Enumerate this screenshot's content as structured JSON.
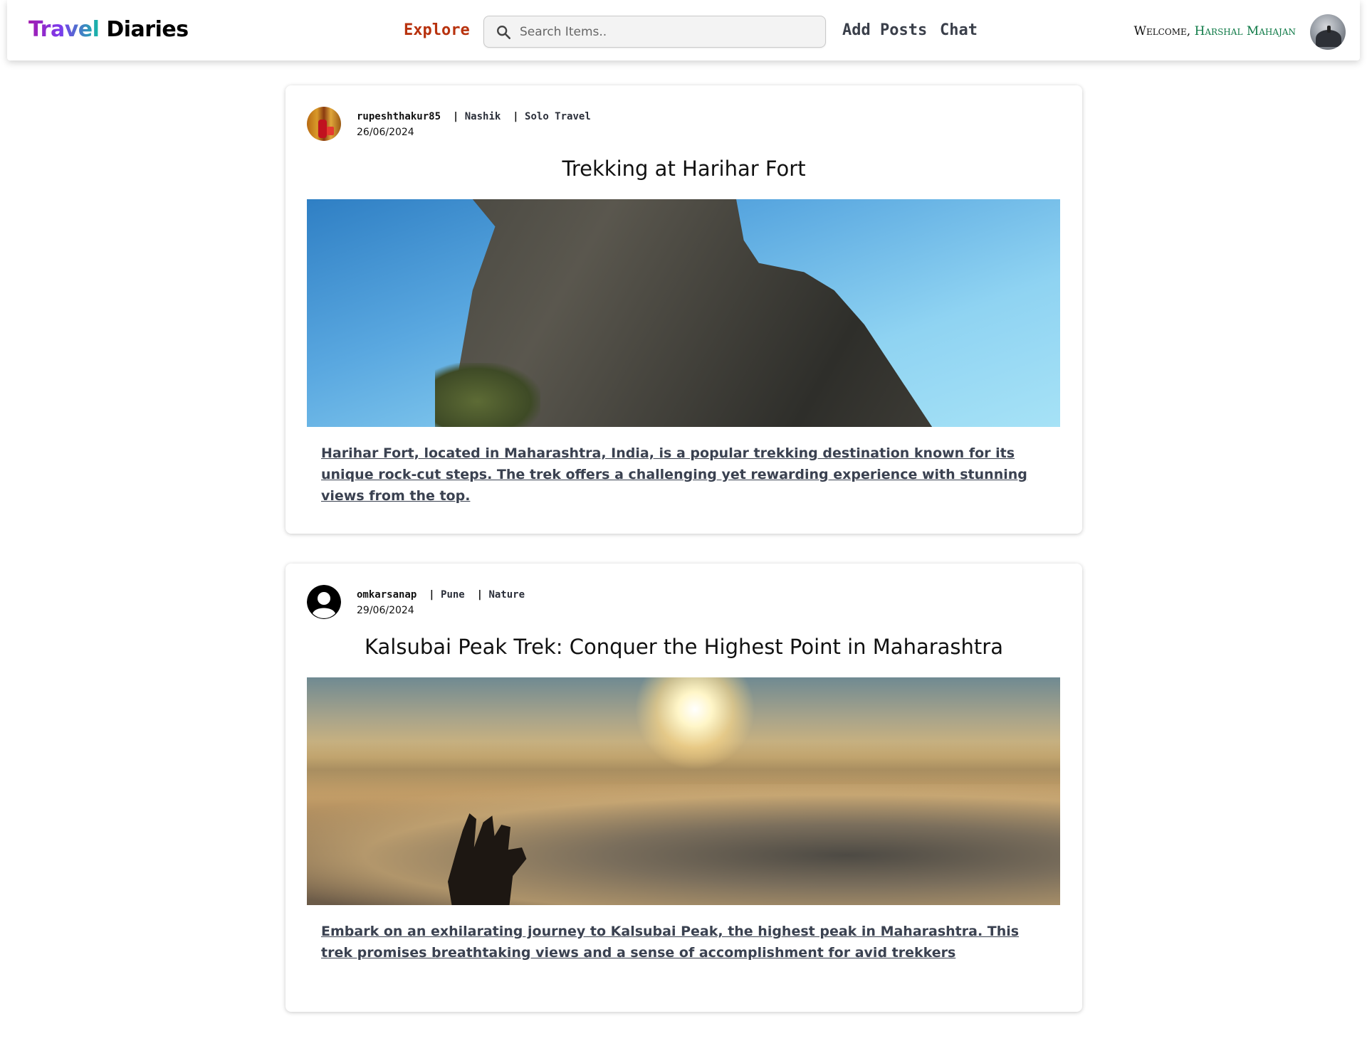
{
  "navbar": {
    "brand_part1": "Travel",
    "brand_part2": "Diaries",
    "explore": "Explore",
    "search_placeholder": "Search Items..",
    "add_posts": "Add Posts",
    "chat": "Chat",
    "welcome_label": "Welcome,",
    "user_name": "Harshal Mahajan",
    "colors": {
      "explore": "#b8320e",
      "user_name": "#0f7a47"
    }
  },
  "posts": [
    {
      "username": "rupeshthakur85",
      "location": "Nashik",
      "category": "Solo Travel",
      "date": "26/06/2024",
      "title": "Trekking at Harihar Fort",
      "description": "Harihar Fort, located in Maharashtra, India, is a popular trekking destination known for its unique rock-cut steps. The trek offers a challenging yet rewarding experience with stunning views from the top.",
      "avatar_icon": "user-photo-avatar"
    },
    {
      "username": "omkarsanap",
      "location": "Pune",
      "category": "Nature",
      "date": "29/06/2024",
      "title": "Kalsubai Peak Trek: Conquer the Highest Point in Maharashtra",
      "description": "Embark on an exhilarating journey to Kalsubai Peak, the highest peak in Maharashtra. This trek promises breathtaking views and a sense of accomplishment for avid trekkers",
      "avatar_icon": "default-user-icon"
    }
  ],
  "icons": {
    "search": "search-icon",
    "profile": "profile-avatar"
  }
}
